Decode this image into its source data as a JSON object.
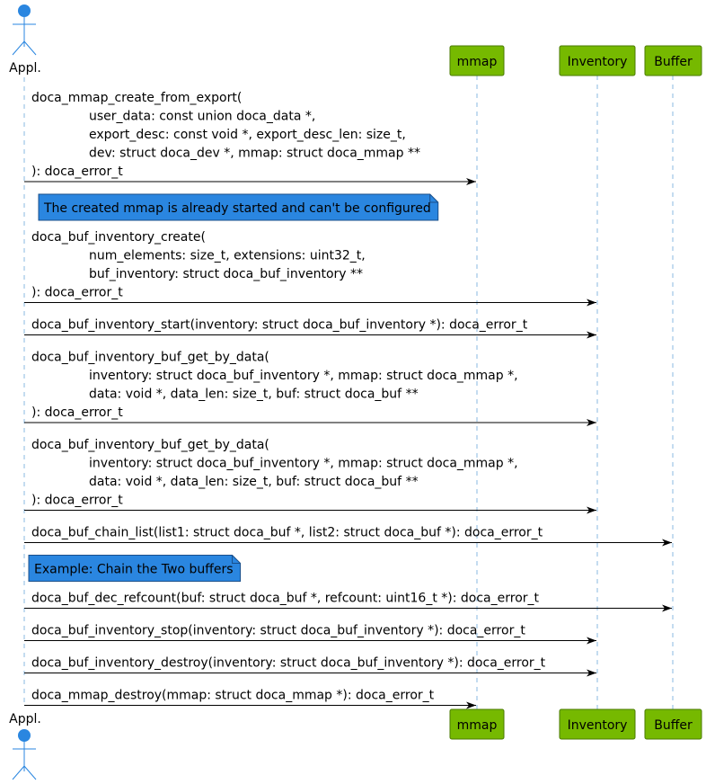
{
  "participants": [
    {
      "id": "appl",
      "label": "Appl.",
      "kind": "actor"
    },
    {
      "id": "mmap",
      "label": "mmap",
      "kind": "participant"
    },
    {
      "id": "inventory",
      "label": "Inventory",
      "kind": "participant"
    },
    {
      "id": "buffer",
      "label": "Buffer",
      "kind": "participant"
    }
  ],
  "colors": {
    "participant_fill": "#76b900",
    "actor": "#2a86e0",
    "note_fill": "#2a86e0",
    "lifeline": "#8ab8e0"
  },
  "steps": [
    {
      "type": "message",
      "from": "appl",
      "to": "mmap",
      "lines": [
        "doca_mmap_create_from_export(",
        "\tuser_data: const union doca_data *,",
        "\texport_desc: const void *, export_desc_len: size_t,",
        "\tdev: struct doca_dev *, mmap: struct doca_mmap **",
        "): doca_error_t"
      ]
    },
    {
      "type": "note",
      "over": "mmap",
      "text": "The created mmap is already started and can't be configured"
    },
    {
      "type": "message",
      "from": "appl",
      "to": "inventory",
      "lines": [
        "doca_buf_inventory_create(",
        "\tnum_elements: size_t, extensions: uint32_t,",
        "\tbuf_inventory: struct doca_buf_inventory **",
        "): doca_error_t"
      ]
    },
    {
      "type": "message",
      "from": "appl",
      "to": "inventory",
      "lines": [
        "doca_buf_inventory_start(inventory: struct doca_buf_inventory *): doca_error_t"
      ]
    },
    {
      "type": "message",
      "from": "appl",
      "to": "inventory",
      "lines": [
        "doca_buf_inventory_buf_get_by_data(",
        "\tinventory: struct doca_buf_inventory *, mmap: struct doca_mmap *,",
        "\tdata: void *, data_len: size_t, buf: struct doca_buf **",
        "): doca_error_t"
      ]
    },
    {
      "type": "message",
      "from": "appl",
      "to": "inventory",
      "lines": [
        "doca_buf_inventory_buf_get_by_data(",
        "\tinventory: struct doca_buf_inventory *, mmap: struct doca_mmap *,",
        "\tdata: void *, data_len: size_t, buf: struct doca_buf **",
        "): doca_error_t"
      ]
    },
    {
      "type": "message",
      "from": "appl",
      "to": "buffer",
      "lines": [
        "doca_buf_chain_list(list1: struct doca_buf *, list2: struct doca_buf *): doca_error_t"
      ]
    },
    {
      "type": "note",
      "over": "appl",
      "text": "Example: Chain the Two buffers"
    },
    {
      "type": "message",
      "from": "appl",
      "to": "buffer",
      "lines": [
        "doca_buf_dec_refcount(buf: struct doca_buf *, refcount: uint16_t *): doca_error_t"
      ]
    },
    {
      "type": "message",
      "from": "appl",
      "to": "inventory",
      "lines": [
        "doca_buf_inventory_stop(inventory: struct doca_buf_inventory *): doca_error_t"
      ]
    },
    {
      "type": "message",
      "from": "appl",
      "to": "inventory",
      "lines": [
        "doca_buf_inventory_destroy(inventory: struct doca_buf_inventory *): doca_error_t"
      ]
    },
    {
      "type": "message",
      "from": "appl",
      "to": "mmap",
      "lines": [
        "doca_mmap_destroy(mmap: struct doca_mmap *): doca_error_t"
      ]
    }
  ]
}
